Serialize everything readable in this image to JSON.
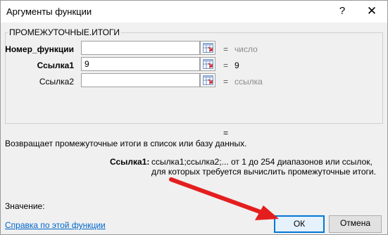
{
  "window": {
    "title": "Аргументы функции",
    "help_label": "?",
    "close_label": "✕"
  },
  "function_group": {
    "name": "ПРОМЕЖУТОЧНЫЕ.ИТОГИ",
    "args": [
      {
        "label": "Номер_функции",
        "value": "",
        "eq": "=",
        "result": "число"
      },
      {
        "label": "Ссылка1",
        "value": "9",
        "eq": "=",
        "result": "9"
      },
      {
        "label": "Ссылка2",
        "value": "",
        "eq": "=",
        "result": "ссылка"
      }
    ]
  },
  "formula_result_eq": "=",
  "description": "Возвращает промежуточные итоги в список или базу данных.",
  "arg_description": {
    "label": "Ссылка1:",
    "text": "ссылка1;ссылка2;... от 1 до 254 диапазонов или ссылок, для которых требуется вычислить промежуточные итоги."
  },
  "value_label": "Значение:",
  "help_link": "Справка по этой функции",
  "buttons": {
    "ok": "ОК",
    "cancel": "Отмена"
  },
  "annotation_arrow_color": "#e41e1e"
}
